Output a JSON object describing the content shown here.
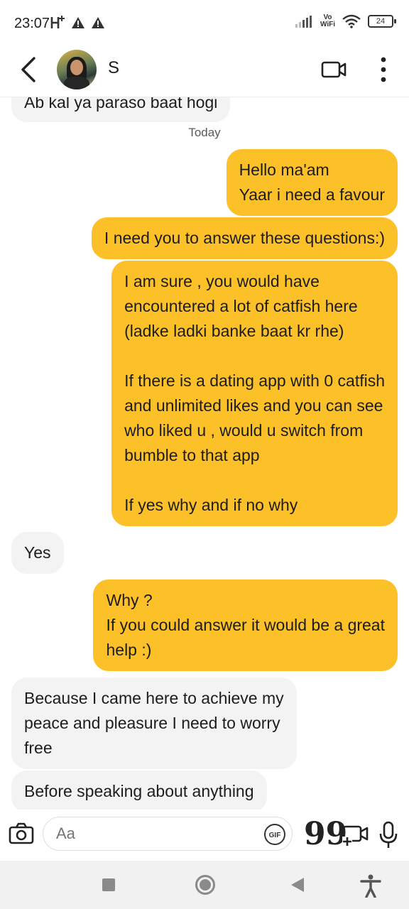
{
  "status_bar": {
    "time": "23:07",
    "network_label_top": "Vo",
    "network_label_bottom": "WiFi",
    "battery": "24"
  },
  "header": {
    "contact_name": "S"
  },
  "chat": {
    "top_partial_message": "Ab kal ya paraso baat hogi",
    "date_separator": "Today",
    "messages": [
      {
        "direction": "sent",
        "text": "Hello ma'am\nYaar i need a favour"
      },
      {
        "direction": "sent",
        "text": "I need you to answer these questions:)"
      },
      {
        "direction": "sent",
        "text": "I am sure , you would have\nencountered a lot of catfish here\n(ladke ladki banke baat kr rhe)\n\nIf there is a dating app with 0 catfish\nand unlimited likes and you can see\nwho liked u , would u switch from\nbumble to that app\n\nIf yes why and if no why"
      },
      {
        "direction": "received",
        "text": "Yes"
      },
      {
        "direction": "sent",
        "text": "Why ?\nIf you could answer it would be a great\nhelp :)"
      },
      {
        "direction": "received",
        "text": "Because I came here to achieve my\npeace and pleasure I need to worry\nfree"
      },
      {
        "direction": "received",
        "text": "Before speaking about anything"
      }
    ]
  },
  "composer": {
    "placeholder": "Aa",
    "gif_label": "GIF",
    "quote_glyph": "99"
  },
  "colors": {
    "sent_bubble": "#fcc028",
    "received_bubble": "#f3f3f3"
  },
  "icons": [
    "back-arrow-icon",
    "video-call-icon",
    "more-vertical-icon",
    "camera-icon",
    "gif-icon",
    "quote-icon",
    "media-add-icon",
    "microphone-icon"
  ]
}
